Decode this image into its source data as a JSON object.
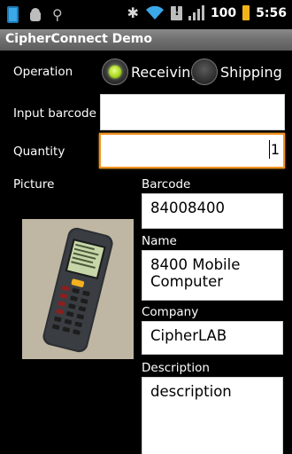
{
  "status_bar": {
    "icons": [
      "phone-icon",
      "android-icon",
      "usb-icon",
      "bluetooth-icon",
      "wifi-icon",
      "sim-alert-icon",
      "signal-icon",
      "battery-icon"
    ],
    "battery": "100",
    "time": "5:56"
  },
  "app": {
    "title": "CipherConnect Demo"
  },
  "form": {
    "operation_label": "Operation",
    "radio_receiving": {
      "label": "Receiving",
      "checked": true
    },
    "radio_shipping": {
      "label": "Shipping",
      "checked": false
    },
    "input_barcode_label": "Input barcode",
    "input_barcode_value": "",
    "quantity_label": "Quantity",
    "quantity_value": "1",
    "picture_label": "Picture",
    "barcode_label": "Barcode",
    "barcode_value": "84008400",
    "name_label": "Name",
    "name_value": "8400 Mobile Computer",
    "company_label": "Company",
    "company_value": "CipherLAB",
    "description_label": "Description",
    "description_value": "description"
  },
  "colors": {
    "focus_border": "#f29324",
    "radio_checked": "#a8d61a",
    "title_bar": "#6f6f6f",
    "battery": "#f2b319",
    "wifi": "#3ba8e8"
  }
}
